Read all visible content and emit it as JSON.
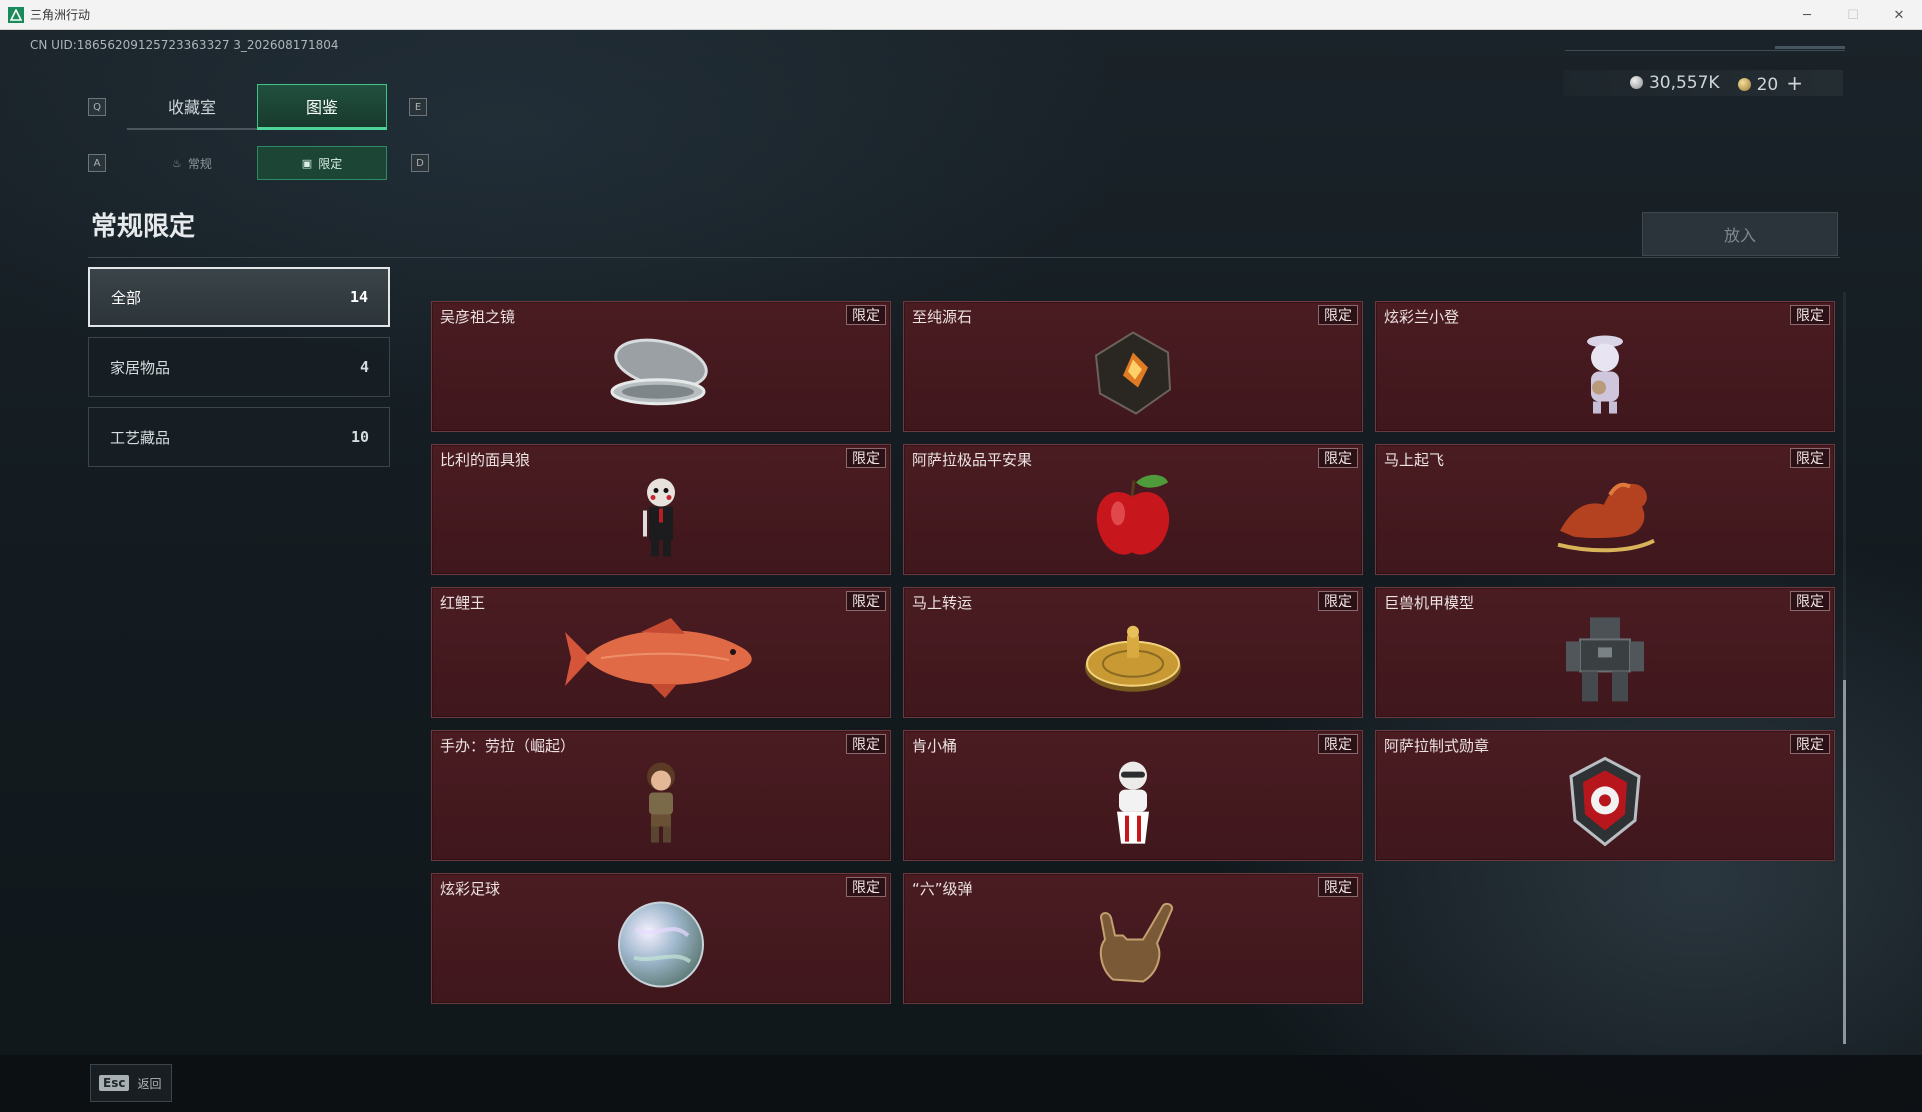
{
  "window": {
    "title": "三角洲行动"
  },
  "uid": "CN UID:18656209125723363327 3_202608171804",
  "currency": {
    "silver": "30,557K",
    "gold": "20",
    "plus": "+"
  },
  "keys": {
    "q": "Q",
    "e": "E",
    "a": "A",
    "d": "D"
  },
  "tabs": [
    {
      "label": "收藏室"
    },
    {
      "label": "图鉴"
    }
  ],
  "subtabs": [
    {
      "label": "常规"
    },
    {
      "label": "限定"
    }
  ],
  "page_title": "常规限定",
  "put_button": "放入",
  "sidebar": [
    {
      "label": "全部",
      "count": "14"
    },
    {
      "label": "家居物品",
      "count": "4"
    },
    {
      "label": "工艺藏品",
      "count": "10"
    }
  ],
  "badge_label": "限定",
  "items": [
    {
      "name": "吴彦祖之镜",
      "icon": "mirror-icon"
    },
    {
      "name": "至纯源石",
      "icon": "source-stone-icon"
    },
    {
      "name": "炫彩兰小登",
      "icon": "figure-icon"
    },
    {
      "name": "比利的面具狼",
      "icon": "masked-doll-icon"
    },
    {
      "name": "阿萨拉极品平安果",
      "icon": "apple-icon"
    },
    {
      "name": "马上起飞",
      "icon": "horse-icon"
    },
    {
      "name": "红鲤王",
      "icon": "carp-icon"
    },
    {
      "name": "马上转运",
      "icon": "golden-disc-icon"
    },
    {
      "name": "巨兽机甲模型",
      "icon": "mech-icon"
    },
    {
      "name": "手办：劳拉（崛起）",
      "icon": "lara-figure-icon"
    },
    {
      "name": "肯小桶",
      "icon": "bucket-figure-icon"
    },
    {
      "name": "阿萨拉制式勋章",
      "icon": "medal-icon"
    },
    {
      "name": "炫彩足球",
      "icon": "football-icon"
    },
    {
      "name": "“六”级弹",
      "icon": "hand-sign-icon"
    }
  ],
  "esc": {
    "key": "Esc",
    "label": "返回"
  },
  "colors": {
    "accent": "#3fc48a",
    "card_bg": "#4a1c22"
  }
}
